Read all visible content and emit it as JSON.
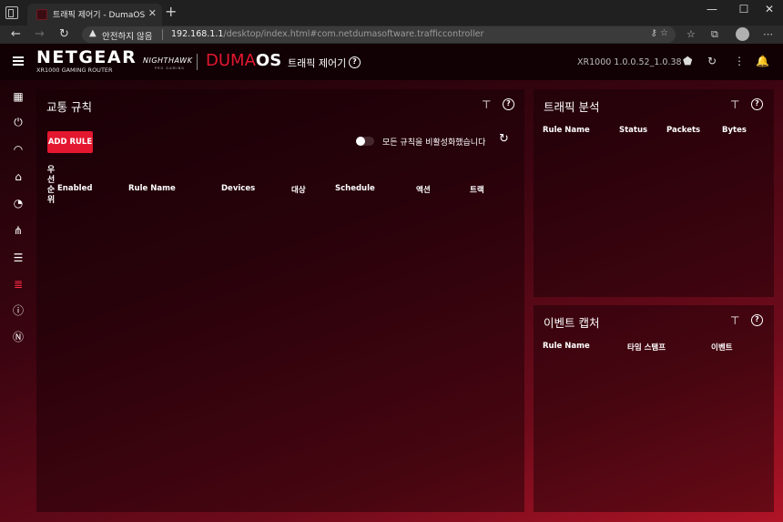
{
  "browser": {
    "tab_title": "트래픽 제어기 - DumaOS",
    "tab_close": "✕",
    "new_tab": "+",
    "window_controls": [
      "—",
      "☐",
      "✕"
    ],
    "nav": {
      "back": "←",
      "forward": "→",
      "reload": "↻"
    },
    "security_label": "안전하지 않음",
    "url_host": "192.168.1.1",
    "url_path": "/desktop/index.html#com.netdumasoftware.trafficcontroller",
    "url_icons": "⚷  ☆",
    "toolbar_icons": [
      "☆",
      "⧉"
    ],
    "menu": "⋯"
  },
  "header": {
    "brand": "NETGEAR",
    "brand_sub": "XR1000 GAMING ROUTER",
    "nighthawk": "NIGHTHAWK",
    "nighthawk_sub": "PRO GAMING",
    "duma_prefix": "DUMA",
    "duma_suffix": "OS",
    "page_title": "트래픽 제어기",
    "help": "?",
    "firmware": "XR1000 1.0.0.52_1.0.38",
    "icons": [
      "⬟",
      "↻",
      "⋮",
      "🔔"
    ]
  },
  "sidebar": {
    "items": [
      {
        "icon": "dashboard-icon",
        "glyph": "▦"
      },
      {
        "icon": "power-icon",
        "glyph": "⏻"
      },
      {
        "icon": "wifi-icon",
        "glyph": "◠"
      },
      {
        "icon": "home-network-icon",
        "glyph": "⌂"
      },
      {
        "icon": "speedometer-icon",
        "glyph": "◔"
      },
      {
        "icon": "network-map-icon",
        "glyph": "⋔"
      },
      {
        "icon": "list-icon",
        "glyph": "☰"
      },
      {
        "icon": "traffic-light-icon",
        "glyph": "≣"
      },
      {
        "icon": "info-icon",
        "glyph": "ⓘ"
      },
      {
        "icon": "netduma-icon",
        "glyph": "Ⓝ"
      }
    ]
  },
  "traffic_rules": {
    "title": "교통 규칙",
    "pin": "⊤",
    "help": "?",
    "add_rule_label": "ADD RULE",
    "toggle_label": "모든 규칙을 비활성화했습니다",
    "refresh": "↻",
    "priority_header": "우\n선\n순\n위",
    "columns": [
      "Enabled",
      "Rule Name",
      "Devices",
      "대상",
      "Schedule",
      "액션",
      "트랙"
    ]
  },
  "traffic_analysis": {
    "title": "트래픽 분석",
    "pin": "⊤",
    "help": "?",
    "columns": [
      "Rule Name",
      "Status",
      "Packets",
      "Bytes"
    ]
  },
  "event_capture": {
    "title": "이벤트 캡처",
    "pin": "⊤",
    "help": "?",
    "columns": [
      "Rule Name",
      "타임 스탬프",
      "이벤트"
    ]
  }
}
